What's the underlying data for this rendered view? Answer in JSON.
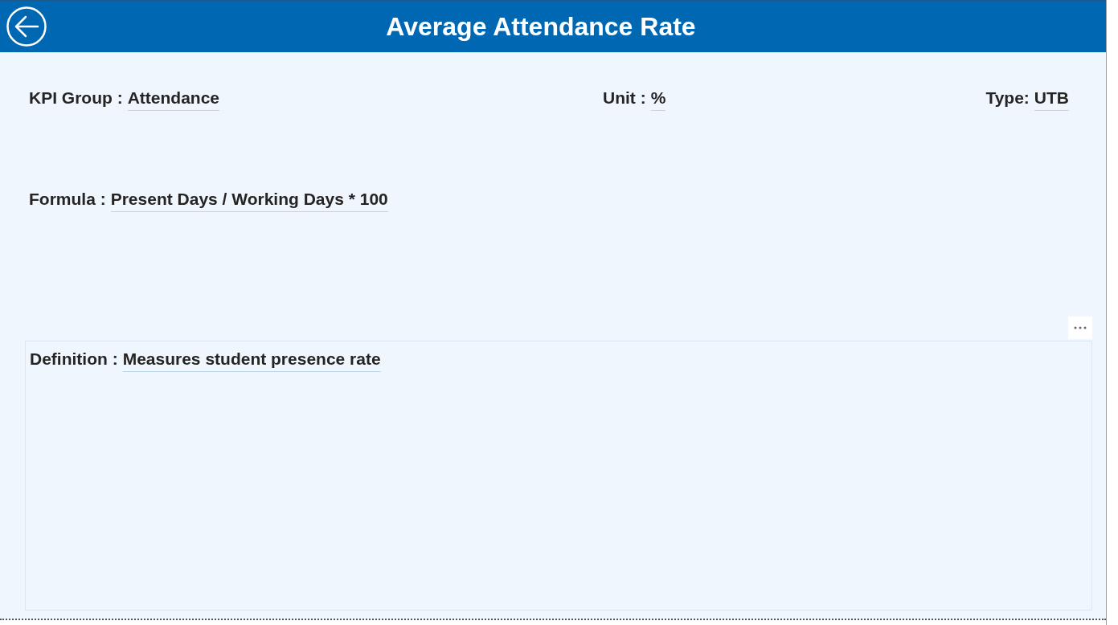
{
  "header": {
    "title": "Average Attendance Rate"
  },
  "fields": [
    {
      "label": "KPI Group :",
      "value": "Attendance"
    },
    {
      "label": "Unit :",
      "value": "%"
    },
    {
      "label": "Type:",
      "value": "UTB"
    }
  ],
  "formula": {
    "label": "Formula :",
    "value": "Present Days / Working Days * 100"
  },
  "definition": {
    "label": "Definition :",
    "value": "Measures student presence rate"
  }
}
